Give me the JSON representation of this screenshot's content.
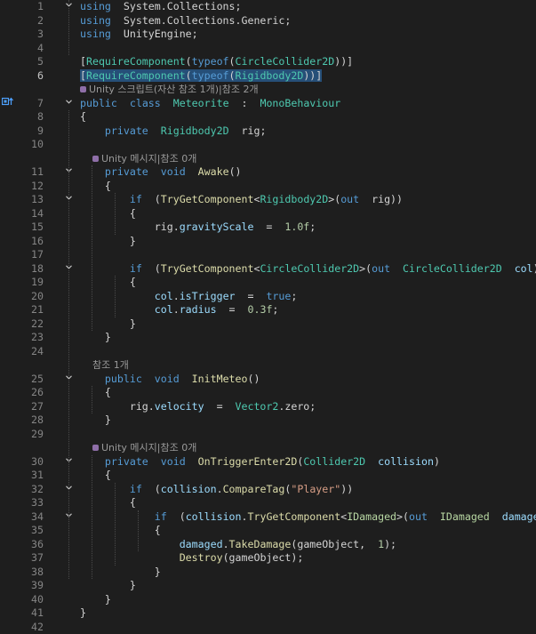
{
  "editor": {
    "current_line": "6",
    "lines": [
      {
        "n": "1",
        "tokens": [
          [
            "kw",
            "using"
          ],
          [
            "",
            "  "
          ],
          [
            "",
            "System.Collections;"
          ]
        ]
      },
      {
        "n": "2",
        "tokens": [
          [
            "kw",
            "using"
          ],
          [
            "",
            "  "
          ],
          [
            "",
            "System.Collections.Generic;"
          ]
        ]
      },
      {
        "n": "3",
        "tokens": [
          [
            "kw",
            "using"
          ],
          [
            "",
            "  "
          ],
          [
            "",
            "UnityEngine;"
          ]
        ]
      },
      {
        "n": "4",
        "tokens": []
      },
      {
        "n": "5",
        "tokens": [
          [
            "",
            "["
          ],
          [
            "ty",
            "RequireComponent"
          ],
          [
            "",
            "("
          ],
          [
            "kw",
            "typeof"
          ],
          [
            "",
            "("
          ],
          [
            "ty",
            "CircleCollider2D"
          ],
          [
            "",
            "))]"
          ]
        ]
      },
      {
        "n": "6",
        "tokens": [
          [
            "",
            "["
          ],
          [
            "ty",
            "RequireComponent"
          ],
          [
            "",
            "("
          ],
          [
            "kw",
            "typeof"
          ],
          [
            "",
            "("
          ],
          [
            "ty",
            "Rigidbody2D"
          ],
          [
            "",
            "))]"
          ]
        ]
      },
      {
        "lens": "Unity 스크립트(자산 참조 1개)|참조 2개",
        "lens_icon": true
      },
      {
        "n": "7",
        "tokens": [
          [
            "kw",
            "public"
          ],
          [
            "",
            "  "
          ],
          [
            "kw",
            "class"
          ],
          [
            "",
            "  "
          ],
          [
            "ty",
            "Meteorite"
          ],
          [
            "",
            "  :  "
          ],
          [
            "ty",
            "MonoBehaviour"
          ]
        ]
      },
      {
        "n": "8",
        "tokens": [
          [
            "",
            "{"
          ]
        ]
      },
      {
        "n": "9",
        "tokens": [
          [
            "",
            "    "
          ],
          [
            "kw",
            "private"
          ],
          [
            "",
            "  "
          ],
          [
            "ty",
            "Rigidbody2D"
          ],
          [
            "",
            "  rig;"
          ]
        ]
      },
      {
        "n": "10",
        "tokens": []
      },
      {
        "lens": "Unity 메시지|참조 0개",
        "lens_icon": true,
        "indent": "    "
      },
      {
        "n": "11",
        "tokens": [
          [
            "",
            "    "
          ],
          [
            "kw",
            "private"
          ],
          [
            "",
            "  "
          ],
          [
            "kw",
            "void"
          ],
          [
            "",
            "  "
          ],
          [
            "fn",
            "Awake"
          ],
          [
            "",
            "()"
          ]
        ]
      },
      {
        "n": "12",
        "tokens": [
          [
            "",
            "    {"
          ]
        ]
      },
      {
        "n": "13",
        "tokens": [
          [
            "",
            "        "
          ],
          [
            "kw",
            "if"
          ],
          [
            "",
            "  ("
          ],
          [
            "fn",
            "TryGetComponent"
          ],
          [
            "",
            "<"
          ],
          [
            "ty",
            "Rigidbody2D"
          ],
          [
            "",
            ">("
          ],
          [
            "kw",
            "out"
          ],
          [
            "",
            "  rig))"
          ]
        ]
      },
      {
        "n": "14",
        "tokens": [
          [
            "",
            "        {"
          ]
        ]
      },
      {
        "n": "15",
        "tokens": [
          [
            "",
            "            rig."
          ],
          [
            "vr",
            "gravityScale"
          ],
          [
            "",
            "  =  "
          ],
          [
            "nm",
            "1.0f"
          ],
          [
            "",
            ";"
          ]
        ]
      },
      {
        "n": "16",
        "tokens": [
          [
            "",
            "        }"
          ]
        ]
      },
      {
        "n": "17",
        "tokens": []
      },
      {
        "n": "18",
        "tokens": [
          [
            "",
            "        "
          ],
          [
            "kw",
            "if"
          ],
          [
            "",
            "  ("
          ],
          [
            "fn",
            "TryGetComponent"
          ],
          [
            "",
            "<"
          ],
          [
            "ty",
            "CircleCollider2D"
          ],
          [
            "",
            ">("
          ],
          [
            "kw",
            "out"
          ],
          [
            "",
            "  "
          ],
          [
            "ty",
            "CircleCollider2D"
          ],
          [
            "",
            "  "
          ],
          [
            "vr",
            "col"
          ],
          [
            "",
            "))"
          ]
        ]
      },
      {
        "n": "19",
        "tokens": [
          [
            "",
            "        {"
          ]
        ]
      },
      {
        "n": "20",
        "tokens": [
          [
            "",
            "            "
          ],
          [
            "vr",
            "col"
          ],
          [
            "",
            "."
          ],
          [
            "vr",
            "isTrigger"
          ],
          [
            "",
            "  =  "
          ],
          [
            "kw",
            "true"
          ],
          [
            "",
            ";"
          ]
        ]
      },
      {
        "n": "21",
        "tokens": [
          [
            "",
            "            "
          ],
          [
            "vr",
            "col"
          ],
          [
            "",
            "."
          ],
          [
            "vr",
            "radius"
          ],
          [
            "",
            "  =  "
          ],
          [
            "nm",
            "0.3f"
          ],
          [
            "",
            ";"
          ]
        ]
      },
      {
        "n": "22",
        "tokens": [
          [
            "",
            "        }"
          ]
        ]
      },
      {
        "n": "23",
        "tokens": [
          [
            "",
            "    }"
          ]
        ]
      },
      {
        "n": "24",
        "tokens": []
      },
      {
        "lens": "참조 1개",
        "lens_icon": false,
        "indent": "    "
      },
      {
        "n": "25",
        "tokens": [
          [
            "",
            "    "
          ],
          [
            "kw",
            "public"
          ],
          [
            "",
            "  "
          ],
          [
            "kw",
            "void"
          ],
          [
            "",
            "  "
          ],
          [
            "fn",
            "InitMeteo"
          ],
          [
            "",
            "()"
          ]
        ]
      },
      {
        "n": "26",
        "tokens": [
          [
            "",
            "    {"
          ]
        ]
      },
      {
        "n": "27",
        "tokens": [
          [
            "",
            "        rig."
          ],
          [
            "vr",
            "velocity"
          ],
          [
            "",
            "  =  "
          ],
          [
            "ty",
            "Vector2"
          ],
          [
            "",
            ".zero;"
          ]
        ]
      },
      {
        "n": "28",
        "tokens": [
          [
            "",
            "    }"
          ]
        ]
      },
      {
        "n": "29",
        "tokens": []
      },
      {
        "lens": "Unity 메시지|참조 0개",
        "lens_icon": true,
        "indent": "    "
      },
      {
        "n": "30",
        "tokens": [
          [
            "",
            "    "
          ],
          [
            "kw",
            "private"
          ],
          [
            "",
            "  "
          ],
          [
            "kw",
            "void"
          ],
          [
            "",
            "  "
          ],
          [
            "fn",
            "OnTriggerEnter2D"
          ],
          [
            "",
            "("
          ],
          [
            "ty",
            "Collider2D"
          ],
          [
            "",
            "  "
          ],
          [
            "vr",
            "collision"
          ],
          [
            "",
            ")"
          ]
        ]
      },
      {
        "n": "31",
        "tokens": [
          [
            "",
            "    {"
          ]
        ]
      },
      {
        "n": "32",
        "tokens": [
          [
            "",
            "        "
          ],
          [
            "kw",
            "if"
          ],
          [
            "",
            "  ("
          ],
          [
            "vr",
            "collision"
          ],
          [
            "",
            "."
          ],
          [
            "fn",
            "CompareTag"
          ],
          [
            "",
            "("
          ],
          [
            "st",
            "\"Player\""
          ],
          [
            "",
            "))"
          ]
        ]
      },
      {
        "n": "33",
        "tokens": [
          [
            "",
            "        {"
          ]
        ]
      },
      {
        "n": "34",
        "tokens": [
          [
            "",
            "            "
          ],
          [
            "kw",
            "if"
          ],
          [
            "",
            "  ("
          ],
          [
            "vr",
            "collision"
          ],
          [
            "",
            "."
          ],
          [
            "fn",
            "TryGetComponent"
          ],
          [
            "",
            "<"
          ],
          [
            "iface",
            "IDamaged"
          ],
          [
            "",
            ">("
          ],
          [
            "kw",
            "out"
          ],
          [
            "",
            "  "
          ],
          [
            "iface",
            "IDamaged"
          ],
          [
            "",
            "  "
          ],
          [
            "vr",
            "damaged"
          ],
          [
            "",
            "))"
          ]
        ]
      },
      {
        "n": "35",
        "tokens": [
          [
            "",
            "            {"
          ]
        ]
      },
      {
        "n": "36",
        "tokens": [
          [
            "",
            "                "
          ],
          [
            "vr",
            "damaged"
          ],
          [
            "",
            "."
          ],
          [
            "fn",
            "TakeDamage"
          ],
          [
            "",
            "(gameObject,  "
          ],
          [
            "nm",
            "1"
          ],
          [
            "",
            ");"
          ]
        ]
      },
      {
        "n": "37",
        "tokens": [
          [
            "",
            "                "
          ],
          [
            "fn",
            "Destroy"
          ],
          [
            "",
            "(gameObject);"
          ]
        ]
      },
      {
        "n": "38",
        "tokens": [
          [
            "",
            "            }"
          ]
        ]
      },
      {
        "n": "39",
        "tokens": [
          [
            "",
            "        }"
          ]
        ]
      },
      {
        "n": "40",
        "tokens": [
          [
            "",
            "    }"
          ]
        ]
      },
      {
        "n": "41",
        "tokens": [
          [
            "",
            "}"
          ]
        ]
      },
      {
        "n": "42",
        "tokens": []
      }
    ],
    "fold_lines": [
      "1",
      "7",
      "11",
      "13",
      "18",
      "25",
      "30",
      "32",
      "34"
    ],
    "marker_line": "7",
    "marker_icon": "class-implementation-icon",
    "highlight_line": "6"
  }
}
